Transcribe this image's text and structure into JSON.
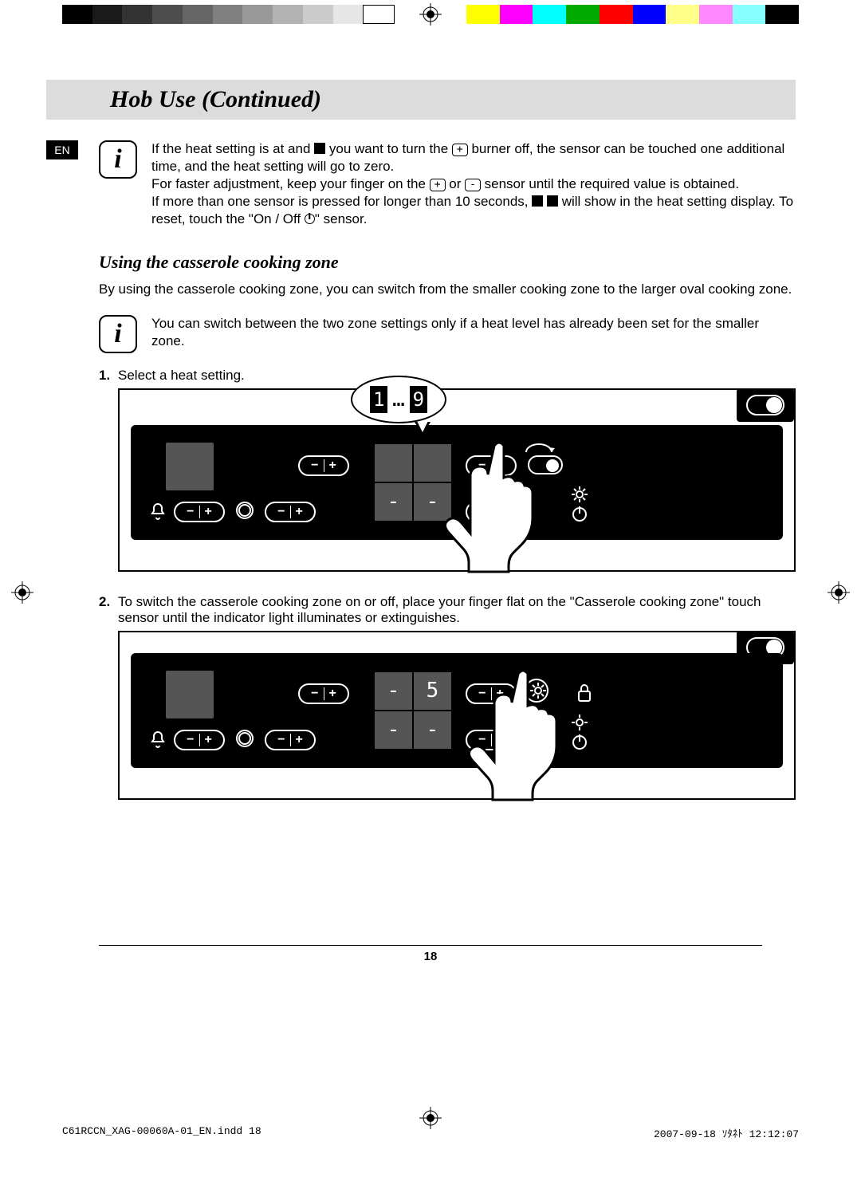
{
  "lang_tab": "EN",
  "section_title": "Hob Use (Continued)",
  "info1": {
    "p1a": "If the heat setting is at and ",
    "p1b": " you want to turn the ",
    "p1c": " burner off, the sensor can be touched one additional time, and the heat setting will go to zero.",
    "p2a": "For faster adjustment, keep your finger on the ",
    "p2b": " or ",
    "p2c": " sensor until the required value is obtained.",
    "p3a": "If more than one sensor is pressed for longer than 10 seconds, ",
    "p3b": " will show in the heat setting display. To reset, touch the \"On / Off ",
    "p3c": "\" sensor."
  },
  "subhead": "Using the casserole cooking zone",
  "intro": "By using the casserole cooking zone, you can switch from the smaller cooking zone to the larger oval cooking zone.",
  "info2": "You can switch between the two zone settings only if a heat level has already been set for the smaller zone.",
  "steps": {
    "s1_num": "1.",
    "s1_text": "Select a heat setting.",
    "s2_num": "2.",
    "s2_text": "To switch the casserole cooking zone on or off, place your finger flat on the \"Casserole cooking zone\" touch sensor until the indicator light illuminates or extinguishes."
  },
  "callout": {
    "left": "1",
    "dots": "…",
    "right": "9"
  },
  "fig2_display": "5",
  "page_number": "18",
  "slug": {
    "file": "C61RCCN_XAG-00060A-01_EN.indd   18",
    "date": "2007-09-18   ｿﾀﾈﾄ 12:12:07"
  }
}
